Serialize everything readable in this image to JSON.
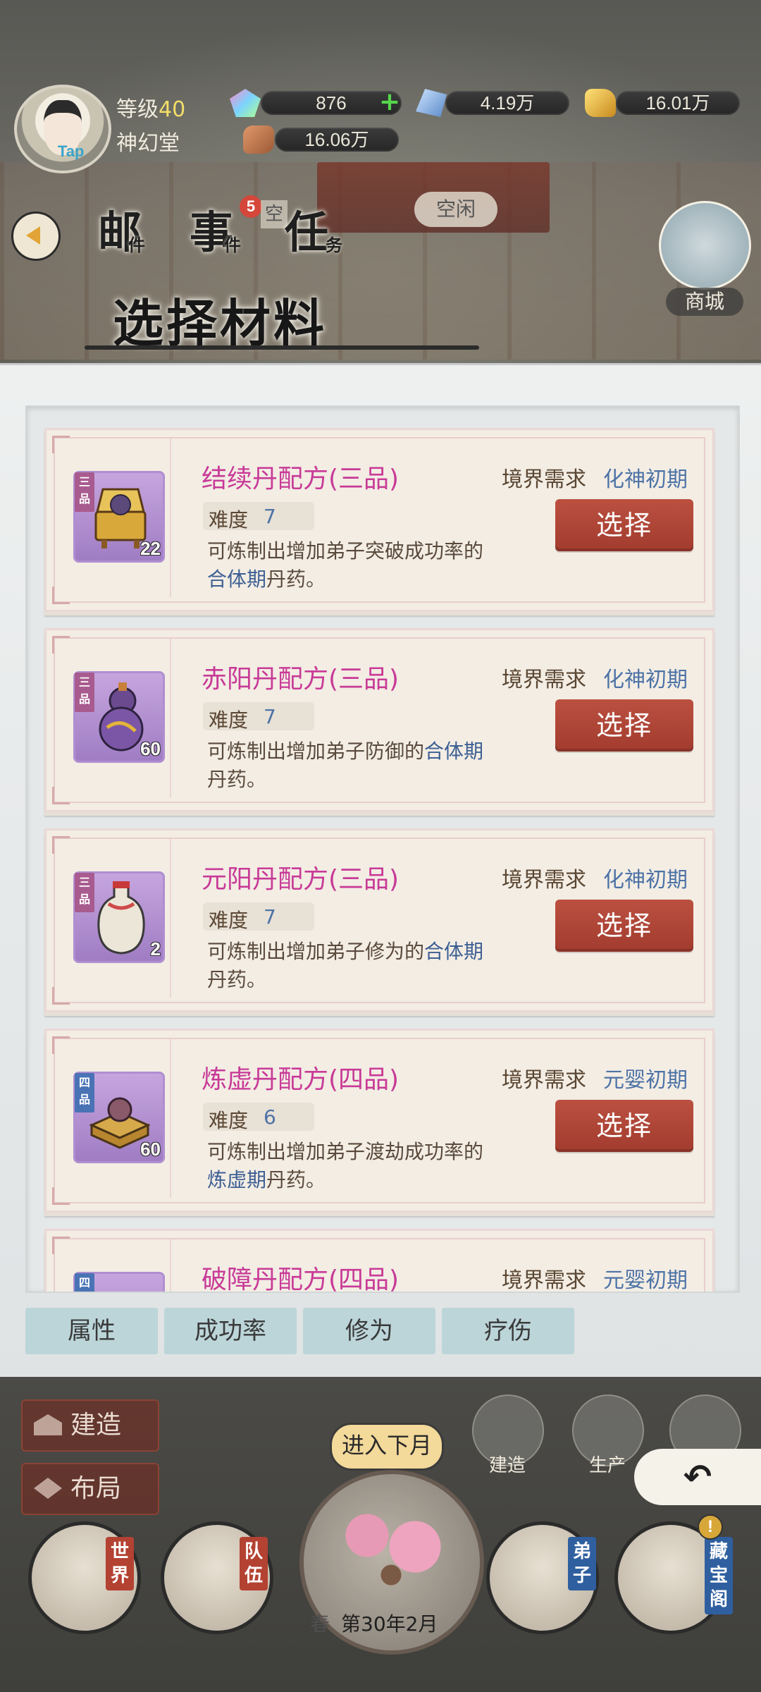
{
  "header": {
    "level_label": "等级",
    "level_value": "40",
    "sect_name": "神幻堂",
    "avatar_badge": "Tap",
    "resources": [
      {
        "name": "gem",
        "value": "876"
      },
      {
        "name": "crystal",
        "value": "4.19万"
      },
      {
        "name": "gold",
        "value": "16.01万"
      },
      {
        "name": "ore",
        "value": "16.06万"
      }
    ]
  },
  "nav": {
    "mail_glyph": "邮",
    "mail_sub": "件",
    "event_glyph": "事",
    "event_sub": "件",
    "event_badge": "5",
    "task_glyph": "任",
    "task_sub": "务",
    "idle_tag": "空闲",
    "idle_tag_small": "空",
    "shop_label": "商城"
  },
  "modal": {
    "title": "选择材料",
    "select_label": "选择",
    "recipes": [
      {
        "name": "结续丹配方(三品)",
        "grade": "三品",
        "count": "22",
        "req_label": "境界需求",
        "req_value": "化神初期",
        "difficulty_label": "难度",
        "difficulty": "7",
        "desc_pre": "可炼制出增加弟子突破成功率的",
        "desc_hl": "合体期",
        "desc_post": "丹药。"
      },
      {
        "name": "赤阳丹配方(三品)",
        "grade": "三品",
        "count": "60",
        "req_label": "境界需求",
        "req_value": "化神初期",
        "difficulty_label": "难度",
        "difficulty": "7",
        "desc_pre": "可炼制出增加弟子防御的",
        "desc_hl": "合体期",
        "desc_post": "丹药。"
      },
      {
        "name": "元阳丹配方(三品)",
        "grade": "三品",
        "count": "2",
        "req_label": "境界需求",
        "req_value": "化神初期",
        "difficulty_label": "难度",
        "difficulty": "7",
        "desc_pre": "可炼制出增加弟子修为的",
        "desc_hl": "合体期",
        "desc_post": "丹药。"
      },
      {
        "name": "炼虚丹配方(四品)",
        "grade": "四品",
        "count": "60",
        "req_label": "境界需求",
        "req_value": "元婴初期",
        "difficulty_label": "难度",
        "difficulty": "6",
        "desc_pre": "可炼制出增加弟子渡劫成功率的",
        "desc_hl": "炼虚期",
        "desc_post": "丹药。"
      },
      {
        "name": "破障丹配方(四品)",
        "grade": "四品",
        "req_label": "境界需求",
        "req_value": "元婴初期"
      }
    ],
    "filter_tabs": [
      "属性",
      "成功率",
      "修为",
      "疗伤"
    ]
  },
  "bottom": {
    "build_label": "建造",
    "layout_label": "布局",
    "build_round_label": "建造",
    "production_label": "生产",
    "next_month_label": "进入下月",
    "season": "春",
    "date": "第30年2月",
    "world_label": "世界",
    "team_label": "队伍",
    "disciple_label": "弟子",
    "treasury_label": "藏宝阁",
    "excl_mark": "!"
  },
  "colors": {
    "recipe_name": "#c83a97",
    "select_button": "#b04637",
    "filter_tab": "#bcd5d9",
    "highlight": "#3d5f93"
  }
}
